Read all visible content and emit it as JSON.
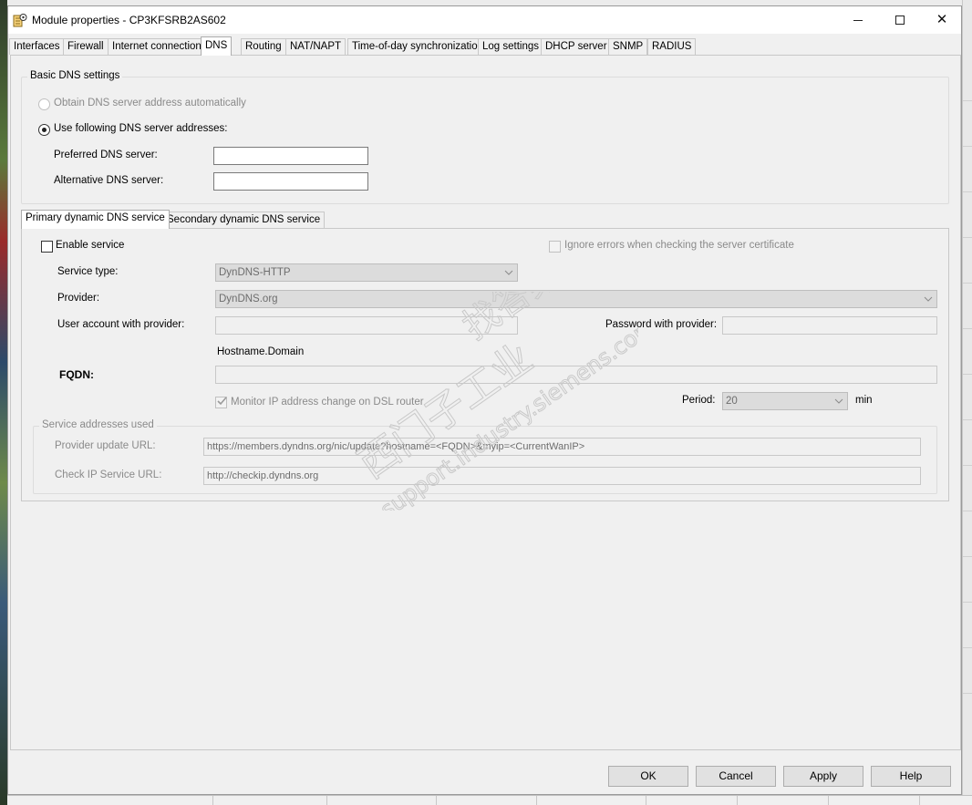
{
  "window": {
    "title": "Module properties - CP3KFSRB2AS602",
    "controls": {
      "minimize": "minimize",
      "maximize": "maximize",
      "close": "✕"
    }
  },
  "tabs": [
    {
      "label": "Interfaces"
    },
    {
      "label": "Firewall"
    },
    {
      "label": "Internet connection"
    },
    {
      "label": "DNS",
      "active": true
    },
    {
      "label": "Routing"
    },
    {
      "label": "NAT/NAPT"
    },
    {
      "label": "Time-of-day synchronization"
    },
    {
      "label": "Log settings"
    },
    {
      "label": "DHCP server"
    },
    {
      "label": "SNMP"
    },
    {
      "label": "RADIUS"
    }
  ],
  "basic_dns": {
    "group_label": "Basic DNS settings",
    "auto_label": "Obtain DNS server address automatically",
    "manual_label": "Use following DNS server addresses:",
    "preferred_label": "Preferred DNS server:",
    "preferred_value": "",
    "alternative_label": "Alternative DNS server:",
    "alternative_value": ""
  },
  "dyn_tabs": [
    {
      "label": "Primary dynamic DNS service",
      "active": true
    },
    {
      "label": "Secondary dynamic DNS service"
    }
  ],
  "dyn": {
    "enable_label": "Enable service",
    "ignore_label": "Ignore errors when checking the server certificate",
    "service_type_label": "Service type:",
    "service_type_value": "DynDNS-HTTP",
    "provider_label": "Provider:",
    "provider_value": "DynDNS.org",
    "user_label": "User account with provider:",
    "password_label": "Password with provider:",
    "hostname_caption": "Hostname.Domain",
    "fqdn_label": "FQDN:",
    "monitor_label": "Monitor IP address change on DSL router",
    "period_label": "Period:",
    "period_value": "20",
    "period_unit": "min",
    "addresses_group_label": "Service addresses used",
    "update_url_label": "Provider update URL:",
    "update_url_value": "https://members.dyndns.org/nic/update?hostname=<FQDN>&myip=<CurrentWanIP>",
    "check_url_label": "Check IP Service URL:",
    "check_url_value": "http://checkip.dyndns.org"
  },
  "buttons": {
    "ok": "OK",
    "cancel": "Cancel",
    "apply": "Apply",
    "help": "Help"
  },
  "watermark": {
    "line1": "西门子工业",
    "line2": "找答案",
    "line3": "support.industry.siemens.com/cs"
  },
  "icons": [
    "settings-icon",
    "chevron-down-icon",
    "checkmark-icon"
  ]
}
